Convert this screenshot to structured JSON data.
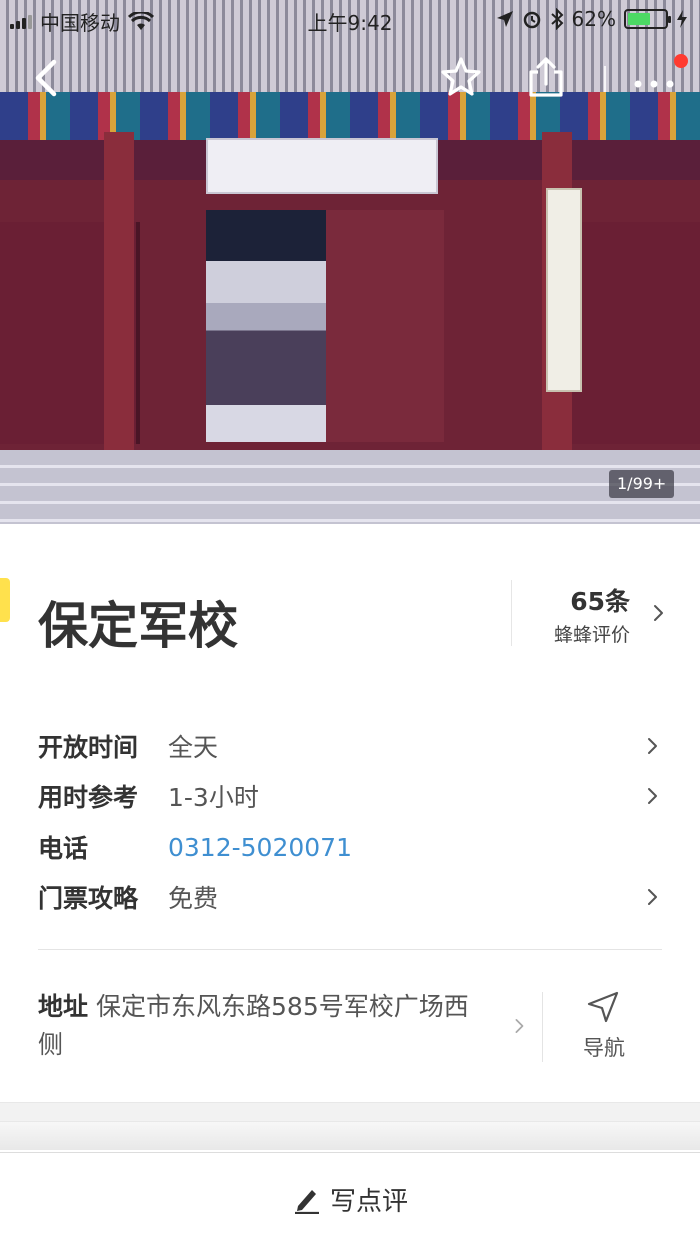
{
  "status_bar": {
    "carrier": "中国移动",
    "time": "上午9:42",
    "battery_percent": "62%",
    "battery_level": 0.62
  },
  "header_nav": {
    "back_icon": "chevron-left-icon",
    "favorite_icon": "star-outline-icon",
    "share_icon": "share-icon",
    "more_icon": "more-dots-icon",
    "notification_dot_color": "#ff3b30"
  },
  "hero": {
    "photo_counter": "1/99+"
  },
  "attraction": {
    "name": "保定军校",
    "accent_color": "#ffe14d",
    "reviews": {
      "count": "65条",
      "label": "蜂蜂评价"
    }
  },
  "info": {
    "rows": [
      {
        "key": "开放时间",
        "value": "全天"
      },
      {
        "key": "用时参考",
        "value": "1-3小时"
      },
      {
        "key": "电话",
        "value": "0312-5020071"
      },
      {
        "key": "门票攻略",
        "value": "免费"
      }
    ],
    "link_color": "#3f8fd1"
  },
  "address": {
    "label": "地址",
    "value": "保定市东风东路585号军校广场西侧",
    "navigate_label": "导航",
    "navigate_icon": "navigation-arrow-icon"
  },
  "bottom_bar": {
    "write_review_label": "写点评",
    "pen_icon": "pen-icon"
  }
}
